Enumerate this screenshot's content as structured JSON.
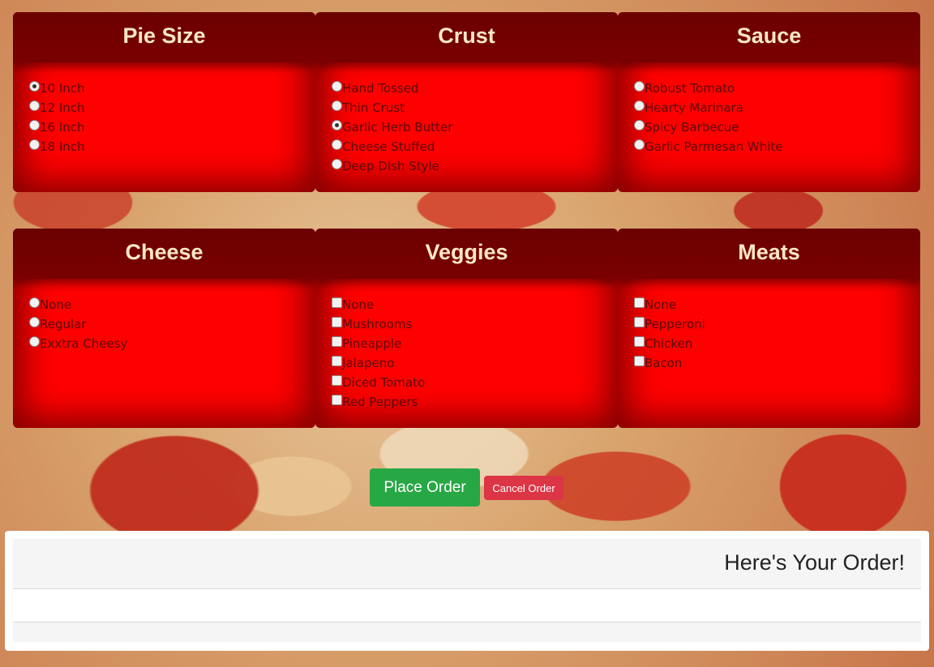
{
  "panels": {
    "size": {
      "title": "Pie Size",
      "options": [
        "10 Inch",
        "12 Inch",
        "16 Inch",
        "18 Inch"
      ]
    },
    "crust": {
      "title": "Crust",
      "options": [
        "Hand Tossed",
        "Thin Crust",
        "Garlic Herb Butter",
        "Cheese Stuffed",
        "Deep Dish Style"
      ]
    },
    "sauce": {
      "title": "Sauce",
      "options": [
        "Robust Tomato",
        "Hearty Marinara",
        "Spicy Barbecue",
        "Garlic Parmesan White"
      ]
    },
    "cheese": {
      "title": "Cheese",
      "options": [
        "None",
        "Regular",
        "Exxtra Cheesy"
      ]
    },
    "veggies": {
      "title": "Veggies",
      "options": [
        "None",
        "Mushrooms",
        "Pineapple",
        "Jalapeno",
        "Diced Tomato",
        "Red Peppers"
      ]
    },
    "meats": {
      "title": "Meats",
      "options": [
        "None",
        "Pepperoni",
        "Chicken",
        "Bacon"
      ]
    }
  },
  "selected": {
    "size": "10 Inch",
    "crust": "Garlic Herb Butter"
  },
  "buttons": {
    "place": "Place Order",
    "cancel": "Cancel Order"
  },
  "order": {
    "title": "Here's Your Order!"
  },
  "colors": {
    "panel": "#ff0000",
    "panel_header": "#6b0000",
    "header_text": "#fbe8c4",
    "place": "#28a745",
    "cancel": "#dc3545"
  }
}
